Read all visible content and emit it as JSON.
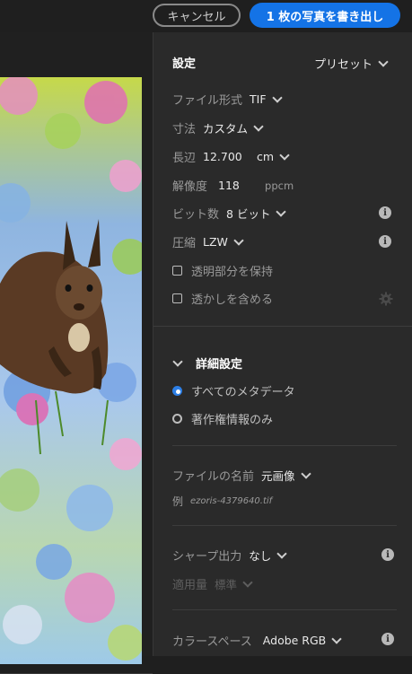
{
  "header": {
    "cancel_label": "キャンセル",
    "export_label": "1 枚の写真を書き出し"
  },
  "settings": {
    "title": "設定",
    "preset_label": "プリセット",
    "file_format": {
      "label": "ファイル形式",
      "value": "TIF"
    },
    "dimensions": {
      "label": "寸法",
      "value": "カスタム"
    },
    "long_edge": {
      "label": "長辺",
      "value": "12.700",
      "unit": "cm"
    },
    "resolution": {
      "label": "解像度",
      "value": "118",
      "unit": "ppcm"
    },
    "bit_depth": {
      "label": "ビット数",
      "value": "8 ビット"
    },
    "compression": {
      "label": "圧縮",
      "value": "LZW"
    },
    "preserve_transparency": {
      "label": "透明部分を保持",
      "checked": false
    },
    "include_watermark": {
      "label": "透かしを含める",
      "checked": false
    }
  },
  "advanced": {
    "title": "詳細設定",
    "metadata_options": [
      {
        "label": "すべてのメタデータ",
        "selected": true
      },
      {
        "label": "著作権情報のみ",
        "selected": false
      }
    ],
    "file_name": {
      "label": "ファイルの名前",
      "value": "元画像"
    },
    "example": {
      "label": "例",
      "value": "ezoris-4379640.tif"
    },
    "sharpen": {
      "label": "シャープ出力",
      "value": "なし"
    },
    "amount": {
      "label": "適用量",
      "value": "標準"
    },
    "color_space": {
      "label": "カラースペース",
      "value": "Adobe RGB"
    }
  },
  "icons": {
    "info": "info-icon",
    "gear": "gear-icon",
    "chevron": "chevron-down-icon",
    "accent": "#1473e6"
  }
}
